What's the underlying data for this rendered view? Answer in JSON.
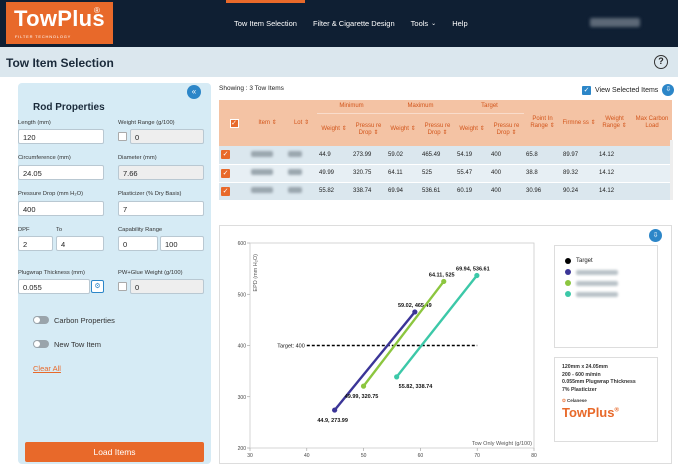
{
  "app": {
    "logo": "TowPlus",
    "logo_mark": "®",
    "logo_sub": "FILTER TECHNOLOGY",
    "nav": [
      "Tow Item Selection",
      "Filter & Cigarette Design",
      "Tools",
      "Help"
    ]
  },
  "page": {
    "title": "Tow Item Selection"
  },
  "rod": {
    "heading": "Rod Properties",
    "length_label": "Length (mm)",
    "length_value": "120",
    "weight_range_label": "Weight Range (g/100)",
    "weight_range_value": "0",
    "circ_label": "Circumference (mm)",
    "circ_value": "24.05",
    "diameter_label": "Diameter (mm)",
    "diameter_value": "7.66",
    "pd_label": "Pressure Drop (mm H₂O)",
    "pd_value": "400",
    "plasticizer_label": "Plasticizer (% Dry Basis)",
    "plasticizer_value": "7",
    "dpf_label": "DPF",
    "to_label": "To",
    "dpf_from": "2",
    "dpf_to": "4",
    "capability_label": "Capability Range",
    "cap_from": "0",
    "cap_to": "100",
    "plugwrap_label": "Plugwrap Thickness (mm)",
    "plugwrap_value": "0.055",
    "pwglue_label": "PW+Glue Weight (g/100)",
    "pwglue_value": "0",
    "carbon_toggle": "Carbon Properties",
    "newtow_toggle": "New Tow Item",
    "clear": "Clear All",
    "load": "Load Items"
  },
  "results": {
    "showing": "Showing : 3 Tow Items",
    "view_selected": "View Selected Items",
    "headers": {
      "item": "Item",
      "lot": "Lot",
      "minimum": "Minimum",
      "maximum": "Maximum",
      "target": "Target",
      "point_in_range": "Point In Range",
      "firmness": "Firmne ss",
      "weight_range": "Weight Range",
      "max_carbon": "Max Carbon Load",
      "weight": "Weight",
      "pressure_drop": "Pressu re Drop"
    },
    "rows": [
      [
        "44.9",
        "273.99",
        "59.02",
        "465.49",
        "54.19",
        "400",
        "65.8",
        "89.97",
        "14.12"
      ],
      [
        "49.99",
        "320.75",
        "64.11",
        "525",
        "55.47",
        "400",
        "38.8",
        "89.32",
        "14.12"
      ],
      [
        "55.82",
        "338.74",
        "69.94",
        "536.61",
        "60.19",
        "400",
        "30.96",
        "90.24",
        "14.12"
      ]
    ]
  },
  "chart_data": {
    "type": "line",
    "xlabel": "Tow Only Weight (g/100)",
    "ylabel": "EPD (mm H₂O)",
    "xlim": [
      30,
      80
    ],
    "ylim": [
      200,
      600
    ],
    "xticks": [
      "30",
      "40",
      "50",
      "60",
      "70",
      "80"
    ],
    "yticks": [
      "200",
      "300",
      "400",
      "500",
      "600"
    ],
    "target": {
      "label": "Target: 400",
      "value": 400,
      "x": [
        40,
        70
      ]
    },
    "series": [
      {
        "color": "#3b3597",
        "points": [
          [
            44.9,
            273.99
          ],
          [
            59.02,
            465.49
          ]
        ],
        "labels": [
          "44.9, 273.99",
          "59.02, 465.49"
        ]
      },
      {
        "color": "#8cc63f",
        "points": [
          [
            49.99,
            320.75
          ],
          [
            64.11,
            525
          ]
        ],
        "labels": [
          "49.99, 320.75",
          "64.11, 525"
        ]
      },
      {
        "color": "#3cc8a8",
        "points": [
          [
            55.82,
            338.74
          ],
          [
            69.94,
            536.61
          ]
        ],
        "labels": [
          "55.82, 338.74",
          "69.94, 536.61"
        ]
      }
    ],
    "legend": {
      "placement": "right",
      "target_label": "Target"
    }
  },
  "info": {
    "lines": [
      "120mm x 24.05mm",
      "200 - 600 m/min",
      "0.055mm Plugwrap Thickness",
      "7% Plasticizer"
    ],
    "brand_small": "Celanese",
    "brand_logo": "TowPlus",
    "brand_mark": "®"
  },
  "colors": {
    "accent": "#e8692a",
    "nav_bg": "#0f1f33",
    "panel": "#d6ebf5",
    "blue": "#2c86c8"
  }
}
